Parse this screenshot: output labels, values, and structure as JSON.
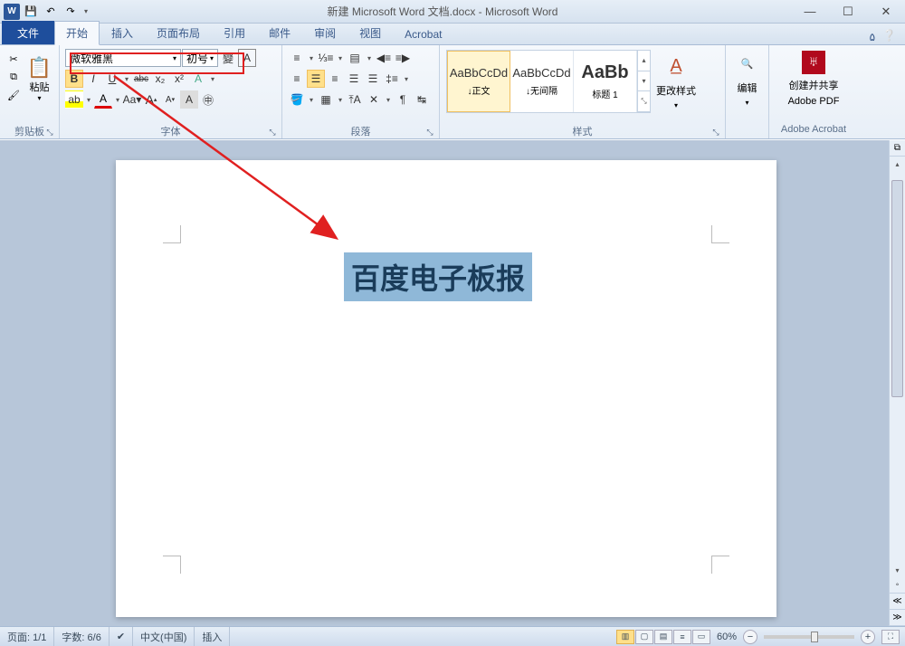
{
  "title": "新建 Microsoft Word 文档.docx - Microsoft Word",
  "qat": {
    "save": "💾",
    "undo": "↶",
    "redo": "↷"
  },
  "tabs": {
    "file": "文件",
    "home": "开始",
    "insert": "插入",
    "layout": "页面布局",
    "ref": "引用",
    "mail": "邮件",
    "review": "审阅",
    "view": "视图",
    "acrobat": "Acrobat"
  },
  "clipboard": {
    "paste": "粘贴",
    "label": "剪贴板"
  },
  "font": {
    "name": "微软雅黑",
    "size": "初号",
    "label": "字体",
    "bold": "B",
    "italic": "I",
    "underline": "U",
    "strike": "abc",
    "sub": "x₂",
    "sup": "x²",
    "grow": "A",
    "shrink": "A",
    "clear": "Aa",
    "case": "Aa▾",
    "phon": "變"
  },
  "paragraph": {
    "label": "段落"
  },
  "styles": {
    "label": "样式",
    "items": [
      {
        "preview": "AaBbCcDd",
        "name": "↓正文"
      },
      {
        "preview": "AaBbCcDd",
        "name": "↓无间隔"
      },
      {
        "preview": "AaBb",
        "name": "标题 1"
      }
    ],
    "change": "更改样式"
  },
  "editing": {
    "label": "编辑"
  },
  "acrobat_group": {
    "line1": "创建并共享",
    "line2": "Adobe PDF",
    "label": "Adobe Acrobat"
  },
  "document": {
    "text": "百度电子板报"
  },
  "status": {
    "page": "页面: 1/1",
    "words": "字数: 6/6",
    "lang": "中文(中国)",
    "mode": "插入",
    "zoom": "60%"
  }
}
